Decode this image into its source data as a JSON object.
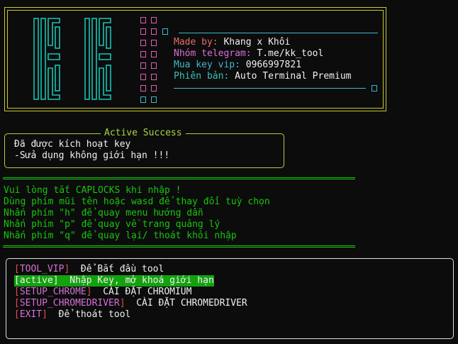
{
  "banner": {
    "made_by_label": "Made by:",
    "made_by_value": " Khang x Khôi",
    "telegram_label": "Nhóm telegram:",
    "telegram_value": " T.me/kk_tool",
    "vip_label": "Mua key vip:",
    "vip_value": " 0966997821",
    "version_label": "Phiên bản:",
    "version_value": " Auto Terminal Premium",
    "logo_text": "KK"
  },
  "active": {
    "title": "Active Success",
    "line1": "Đã được kích hoạt key",
    "line2": "-Sửa dụng không giới hạn !!!"
  },
  "instructions": [
    "Vui lòng tắt CAPLOCKS khi nhập !",
    "Dùng phím mũi tên hoặc wasd để thay đổi tuỳ chọn",
    "Nhấn phím \"h\" để quay menu hướng dẫn",
    "Nhấn phím \"p\" để quay về trang quảng lý",
    "Nhấn phím \"q\" để quay lại/ thoát khỏi nhập"
  ],
  "menu": [
    {
      "key": "TOOL_VIP",
      "desc": "  Để Bắt đầu tool",
      "selected": false
    },
    {
      "key": "active",
      "desc": "  Nhập Key, mở khoá giới hạn",
      "selected": true
    },
    {
      "key": "SETUP_CHROME",
      "desc": "  CÀI ĐẶT CHROMIUM",
      "selected": false
    },
    {
      "key": "SETUP_CHROMEDRIVER",
      "desc": "  CÀI ĐẶT CHROMEDRIVER",
      "selected": false
    },
    {
      "key": "EXIT",
      "desc": "  Để thoát tool",
      "selected": false
    }
  ],
  "colors": {
    "banner_border": "#c9c92f",
    "logo": "#16c3b4",
    "active_border": "#a8d341",
    "instruction_text": "#16c60c",
    "menu_bracket": "#e74856",
    "menu_key": "#d670d6",
    "menu_selected_bg": "#13a10e"
  }
}
